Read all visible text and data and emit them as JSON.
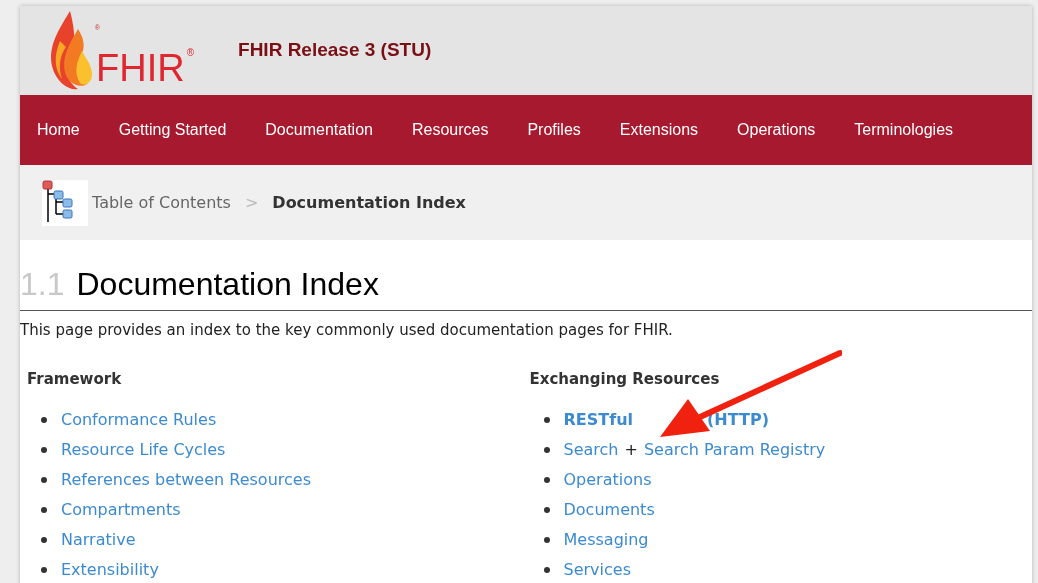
{
  "logo": {
    "flame_mark": "®",
    "text": "FHIR",
    "mark": "®"
  },
  "site_title": "FHIR Release 3 (STU)",
  "nav": [
    {
      "label": "Home"
    },
    {
      "label": "Getting Started"
    },
    {
      "label": "Documentation"
    },
    {
      "label": "Resources"
    },
    {
      "label": "Profiles"
    },
    {
      "label": "Extensions"
    },
    {
      "label": "Operations"
    },
    {
      "label": "Terminologies"
    }
  ],
  "breadcrumb": {
    "items": [
      "Table of Contents"
    ],
    "separator": ">",
    "current": "Documentation Index"
  },
  "heading": {
    "number": "1.1",
    "title": "Documentation Index"
  },
  "intro": "This page provides an index to the key commonly used documentation pages for FHIR.",
  "columns": [
    {
      "title": "Framework",
      "items": [
        {
          "parts": [
            {
              "text": "Conformance Rules",
              "link": true,
              "bold": false
            }
          ]
        },
        {
          "parts": [
            {
              "text": "Resource Life Cycles",
              "link": true,
              "bold": false
            }
          ]
        },
        {
          "parts": [
            {
              "text": "References between Resources",
              "link": true,
              "bold": false
            }
          ]
        },
        {
          "parts": [
            {
              "text": "Compartments",
              "link": true,
              "bold": false
            }
          ]
        },
        {
          "parts": [
            {
              "text": "Narrative",
              "link": true,
              "bold": false
            }
          ]
        },
        {
          "parts": [
            {
              "text": "Extensibility",
              "link": true,
              "bold": false
            }
          ]
        }
      ]
    },
    {
      "title": "Exchanging Resources",
      "items": [
        {
          "parts": [
            {
              "text": "RESTful",
              "link": true,
              "bold": true
            },
            {
              "text": "(HTTP)",
              "link": true,
              "bold": true
            }
          ]
        },
        {
          "parts": [
            {
              "text": "Search",
              "link": true,
              "bold": false
            },
            {
              "text": "+",
              "link": false,
              "bold": false
            },
            {
              "text": "Search Param Registry",
              "link": true,
              "bold": false
            }
          ]
        },
        {
          "parts": [
            {
              "text": "Operations",
              "link": true,
              "bold": false
            }
          ]
        },
        {
          "parts": [
            {
              "text": "Documents",
              "link": true,
              "bold": false
            }
          ]
        },
        {
          "parts": [
            {
              "text": "Messaging",
              "link": true,
              "bold": false
            }
          ]
        },
        {
          "parts": [
            {
              "text": "Services",
              "link": true,
              "bold": false
            }
          ]
        }
      ]
    }
  ]
}
